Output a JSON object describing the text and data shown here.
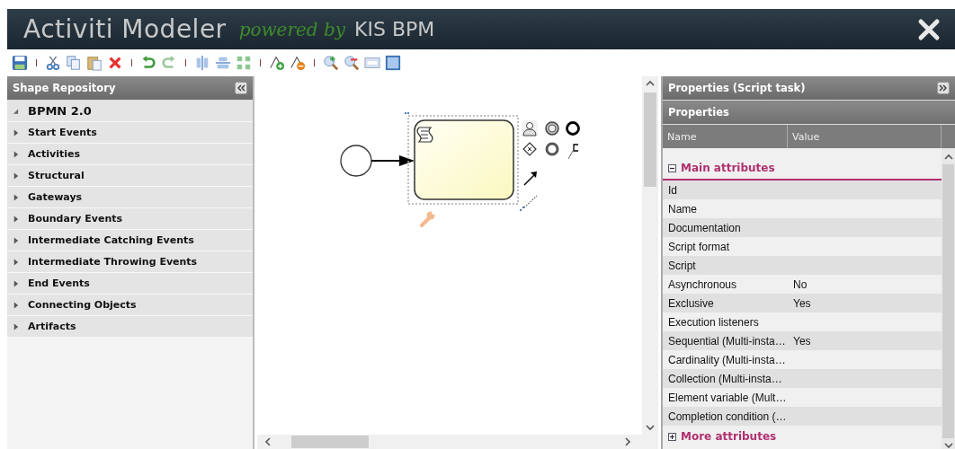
{
  "window": {
    "title": "Activiti Modeler",
    "tagline": "powered by",
    "brand": "KIS BPM"
  },
  "shape_repository": {
    "title": "Shape Repository",
    "root": {
      "label": "BPMN 2.0",
      "expanded": true,
      "children": [
        {
          "label": "Start Events",
          "expanded": false
        },
        {
          "label": "Activities",
          "expanded": false
        },
        {
          "label": "Structural",
          "expanded": false
        },
        {
          "label": "Gateways",
          "expanded": false
        },
        {
          "label": "Boundary Events",
          "expanded": false
        },
        {
          "label": "Intermediate Catching Events",
          "expanded": false
        },
        {
          "label": "Intermediate Throwing Events",
          "expanded": false
        },
        {
          "label": "End Events",
          "expanded": false
        },
        {
          "label": "Connecting Objects",
          "expanded": false
        },
        {
          "label": "Artifacts",
          "expanded": false
        }
      ]
    }
  },
  "properties_panel": {
    "title": "Properties (Script task)",
    "section_title": "Properties",
    "columns": [
      "Name",
      "Value"
    ],
    "groups": [
      {
        "label": "Main attributes",
        "expanded": true,
        "rows": [
          {
            "name": "Id"
          },
          {
            "name": "Name"
          },
          {
            "name": "Documentation"
          },
          {
            "name": "Script format"
          },
          {
            "name": "Script"
          },
          {
            "name": "Asynchronous",
            "value": "No"
          },
          {
            "name": "Exclusive",
            "value": "Yes"
          },
          {
            "name": "Execution listeners"
          },
          {
            "name": "Sequential (Multi-insta…",
            "value": "Yes"
          },
          {
            "name": "Cardinality (Multi-insta…"
          },
          {
            "name": "Collection (Multi-insta…"
          },
          {
            "name": "Element variable (Mult…"
          },
          {
            "name": "Completion condition (…"
          }
        ]
      },
      {
        "label": "More attributes",
        "expanded": false
      }
    ]
  }
}
